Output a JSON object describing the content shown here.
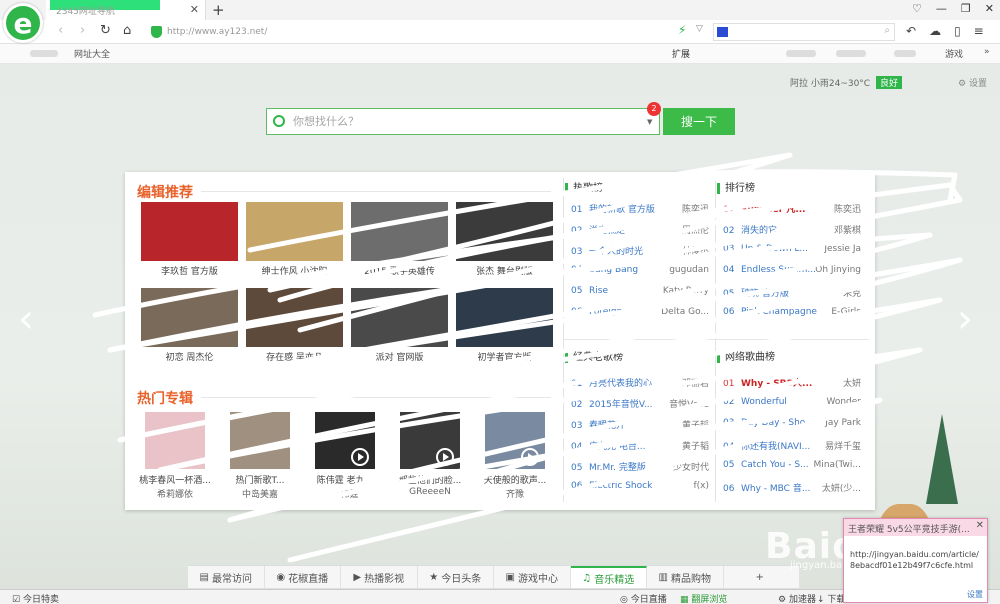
{
  "browser": {
    "tab_title": "2345网址导航",
    "address": "http://www.ay123.net/",
    "search_placeholder": "",
    "toolbar_icons": [
      "back-icon",
      "forward-icon",
      "refresh-icon",
      "home-icon"
    ],
    "window_icons": [
      "skin-icon",
      "minimize-icon",
      "restore-icon",
      "close-icon"
    ]
  },
  "favbar": {
    "items": [
      "网址大全",
      "扩展",
      "游戏"
    ]
  },
  "page": {
    "weather_text": "阿拉 小雨24~30°C",
    "weather_badge": "良好",
    "settings_label": "设置",
    "search": {
      "placeholder": "你想找什么？",
      "badge": "2",
      "button": "搜一下"
    },
    "editor_title": "编辑推荐",
    "editor_items": [
      {
        "caption": "李玖哲 官方版",
        "color": "#b8262b"
      },
      {
        "caption": "绅士作风 小沈阳",
        "color": "#c7a66a"
      },
      {
        "caption": "2015 歌手英雄传",
        "color": "#6d6d6d"
      },
      {
        "caption": "张杰 舞台剧版",
        "color": "#3b3b3b"
      },
      {
        "caption": "初恋 周杰伦",
        "color": "#7a6a5a"
      },
      {
        "caption": "存在感 吴亦凡",
        "color": "#5d4a3a"
      },
      {
        "caption": "派对 官网版",
        "color": "#4a4a4a"
      },
      {
        "caption": "初学者官方版",
        "color": "#2d3b4a"
      }
    ],
    "album_title": "热门专辑",
    "albums": [
      {
        "title": "桃李春风一杯酒...",
        "artist": "希莉娜依",
        "color": "#e9c3c7"
      },
      {
        "title": "热门新歌T...",
        "artist": "中岛美嘉",
        "color": "#a09080"
      },
      {
        "title": "陈伟霆 老九...",
        "artist": "陈伟霆",
        "color": "#2a2a2a"
      },
      {
        "title": "那些他们的脸...",
        "artist": "GReeeeN",
        "color": "#3a3a3a"
      },
      {
        "title": "天使般的歌声...",
        "artist": "齐豫",
        "color": "#7a8aa0"
      }
    ],
    "hot_title": "热歌榜",
    "hot_list": [
      {
        "n": "01",
        "song": "我的新歌 官方版",
        "artist": "陈奕迅"
      },
      {
        "n": "02",
        "song": "说走就走",
        "artist": "周杰伦"
      },
      {
        "n": "03",
        "song": "一个人的时光",
        "artist": "林俊杰"
      },
      {
        "n": "04",
        "song": "Bang Bang",
        "artist": "gugudan"
      },
      {
        "n": "05",
        "song": "Rise",
        "artist": "Katy Perry"
      },
      {
        "n": "06",
        "song": "Foreign",
        "artist": "Delta Go..."
      }
    ],
    "top_title": "排行榜",
    "top_list": [
      {
        "n": "01",
        "song": "Summer 凡...",
        "artist": "陈奕迅"
      },
      {
        "n": "02",
        "song": "消失的它",
        "artist": "邓紫棋"
      },
      {
        "n": "03",
        "song": "Up & Down L...",
        "artist": "Jessie Ja"
      },
      {
        "n": "04",
        "song": "Endless Summ...",
        "artist": "Oh Jinying"
      },
      {
        "n": "05",
        "song": "破晓 官方版",
        "artist": "朱克"
      },
      {
        "n": "06",
        "song": "Pink Champagne",
        "artist": "E-Girls"
      }
    ],
    "classic_title": "经典老歌榜",
    "classic_list": [
      {
        "n": "01",
        "song": "月亮代表我的心",
        "artist": "邓丽君"
      },
      {
        "n": "02",
        "song": "2015年音悦V...",
        "artist": "音悦Vsee"
      },
      {
        "n": "03",
        "song": "春暖花开",
        "artist": "黄子韬"
      },
      {
        "n": "04",
        "song": "广九光 电台...",
        "artist": "黄子韬"
      },
      {
        "n": "05",
        "song": "Mr.Mr. 完整版",
        "artist": "少女时代"
      },
      {
        "n": "06",
        "song": "Electric Shock",
        "artist": "f(x)"
      }
    ],
    "net_title": "网络歌曲榜",
    "net_list": [
      {
        "n": "01",
        "song": "Why - SBS人...",
        "artist": "太妍"
      },
      {
        "n": "02",
        "song": "Wonderful",
        "artist": "Wonder"
      },
      {
        "n": "03",
        "song": "Day Day - Sho...",
        "artist": "Jay Park"
      },
      {
        "n": "04",
        "song": "你还有我(NAVI...",
        "artist": "易烊千玺"
      },
      {
        "n": "05",
        "song": "Catch You - S...",
        "artist": "Mina(Twi..."
      },
      {
        "n": "06",
        "song": "Why - MBC 音...",
        "artist": "太妍(少..."
      }
    ]
  },
  "bottom_nav": [
    {
      "label": "最常访问",
      "icon": "list-icon"
    },
    {
      "label": "花椒直播",
      "icon": "eye-icon"
    },
    {
      "label": "热播影视",
      "icon": "play-icon"
    },
    {
      "label": "今日头条",
      "icon": "star-icon"
    },
    {
      "label": "游戏中心",
      "icon": "gamepad-icon"
    },
    {
      "label": "音乐精选",
      "icon": "music-icon",
      "active": true
    },
    {
      "label": "精品购物",
      "icon": "bag-icon"
    },
    {
      "label": "",
      "icon": "plus-icon"
    }
  ],
  "status": {
    "left": "今日特卖",
    "live": "今日直播",
    "browse": "翻屏浏览",
    "accel": "加速器",
    "download": "下载"
  },
  "popup": {
    "title": "王者荣耀 5v5公平竞技手游(...",
    "url": "http://jingyan.baidu.com/article/8ebacdf01e12b49f7c6cfe.html",
    "settings": "设置"
  },
  "watermark": {
    "text": "Baidu经验",
    "sub": "jingyan.baidu.com"
  }
}
